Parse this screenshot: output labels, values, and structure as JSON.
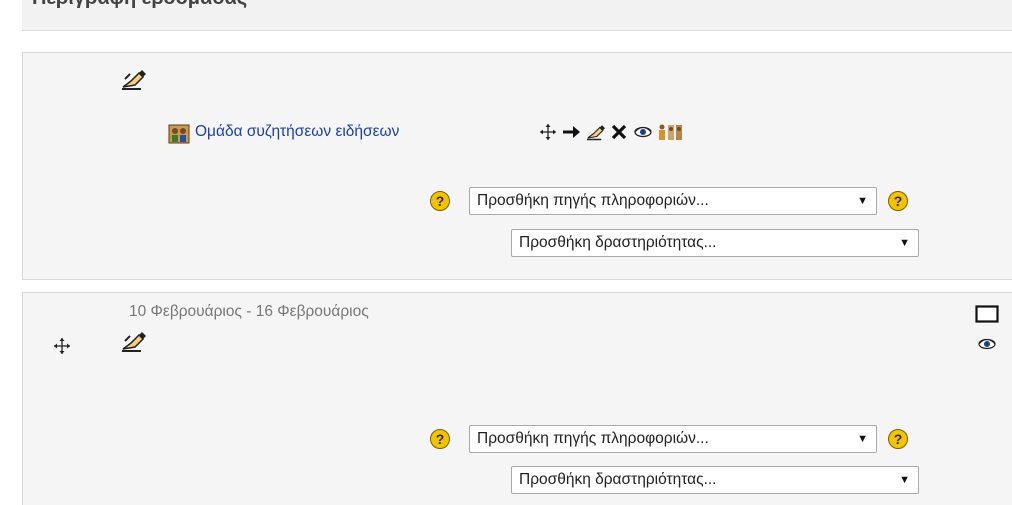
{
  "header": {
    "title": "Περιγραφή εβδομάδας"
  },
  "section1": {
    "activity": {
      "icon": "forum-icon",
      "label": "Ομάδα συζητήσεων ειδήσεων",
      "tools": [
        "move-icon",
        "indent-right-icon",
        "edit-icon",
        "delete-icon",
        "hide-icon",
        "group-mode-icon"
      ]
    },
    "add_resource": {
      "selected": "Προσθήκη πηγής πληροφοριών...",
      "help": "?"
    },
    "add_activity": {
      "selected": "Προσθήκη δραστηριότητας..."
    }
  },
  "section2": {
    "date_range": "10 Φεβρουάριος - 16 Φεβρουάριος",
    "add_resource": {
      "selected": "Προσθήκη πηγής πληροφοριών...",
      "help": "?"
    },
    "add_activity": {
      "selected": "Προσθήκη δραστηριότητας..."
    }
  },
  "colors": {
    "link": "#1a3fa6",
    "section_bg": "#f5f5f5",
    "border": "#d9d9d9",
    "help_yellow": "#f2c400"
  }
}
